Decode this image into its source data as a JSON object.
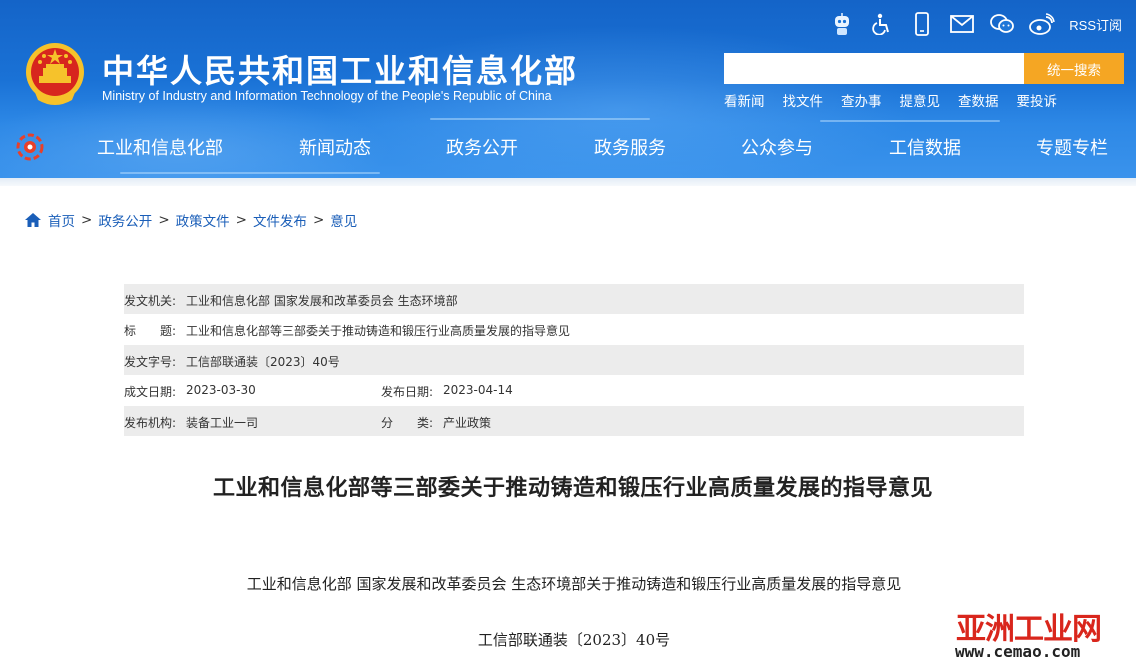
{
  "header": {
    "title_cn": "中华人民共和国工业和信息化部",
    "title_en": "Ministry of Industry and Information Technology of the People's Republic of China",
    "icons": [
      "robot-assistant-icon",
      "accessibility-icon",
      "mobile-icon",
      "mail-icon",
      "wechat-icon",
      "weibo-icon"
    ],
    "rss_label": "RSS订阅",
    "search": {
      "placeholder": "",
      "button_label": "统一搜索"
    },
    "quick_links": [
      "看新闻",
      "找文件",
      "查办事",
      "提意见",
      "查数据",
      "要投诉"
    ],
    "nav": [
      "工业和信息化部",
      "新闻动态",
      "政务公开",
      "政务服务",
      "公众参与",
      "工信数据",
      "专题专栏"
    ],
    "colors": {
      "header_blue": "#1a72d6",
      "search_button": "#f5a623"
    }
  },
  "breadcrumb": [
    "首页",
    "政务公开",
    "政策文件",
    "文件发布",
    "意见"
  ],
  "info": {
    "issuer_label": "发文机关:",
    "issuer": "工业和信息化部 国家发展和改革委员会 生态环境部",
    "title_label": "标　　题:",
    "title": "工业和信息化部等三部委关于推动铸造和锻压行业高质量发展的指导意见",
    "doc_no_label": "发文字号:",
    "doc_no": "工信部联通装〔2023〕40号",
    "written_label": "成文日期:",
    "written": "2023-03-30",
    "published_label": "发布日期:",
    "published": "2023-04-14",
    "org_label": "发布机构:",
    "org": "装备工业一司",
    "category_label": "分　　类:",
    "category": "产业政策"
  },
  "article": {
    "title": "工业和信息化部等三部委关于推动铸造和锻压行业高质量发展的指导意见",
    "subtitle": "工业和信息化部 国家发展和改革委员会 生态环境部关于推动铸造和锻压行业高质量发展的指导意见",
    "doc_number": "工信部联通装〔2023〕40号"
  },
  "watermark": {
    "cn": "亚洲工业网",
    "url": "www.cemao.com"
  }
}
